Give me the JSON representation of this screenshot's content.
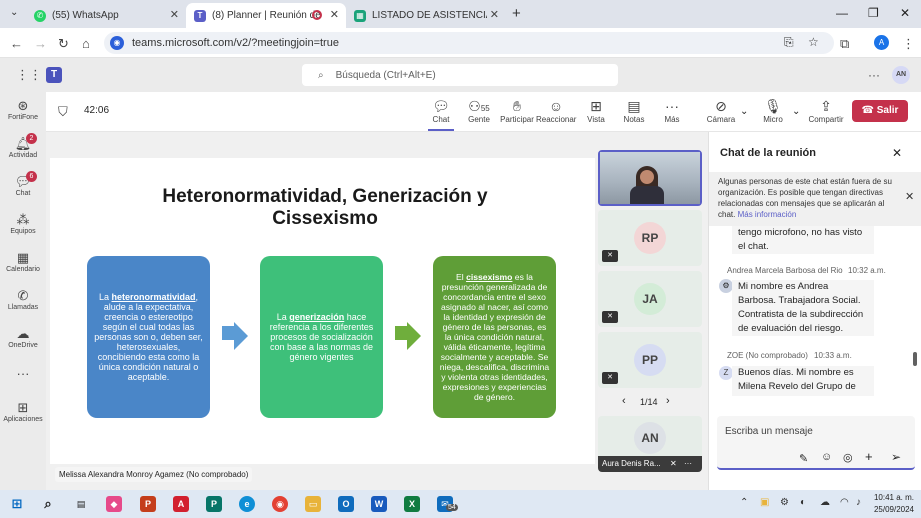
{
  "browser": {
    "tabs": [
      {
        "label": "(55) WhatsApp"
      },
      {
        "label": "(8) Planner | Reunión de Ma"
      },
      {
        "label": "LISTADO DE ASISTENCIA - ASIS"
      }
    ],
    "url": "teams.microsoft.com/v2/?meetingjoin=true",
    "profile": "A"
  },
  "teams": {
    "search_placeholder": "Búsqueda (Ctrl+Alt+E)",
    "user_initials": "AN",
    "rail": [
      {
        "label": "FortiFone",
        "badge": ""
      },
      {
        "label": "Actividad",
        "badge": "2"
      },
      {
        "label": "Chat",
        "badge": "6"
      },
      {
        "label": "Equipos",
        "badge": ""
      },
      {
        "label": "Calendario",
        "badge": ""
      },
      {
        "label": "Llamadas",
        "badge": ""
      },
      {
        "label": "OneDrive",
        "badge": ""
      },
      {
        "label": "Aplicaciones",
        "badge": ""
      }
    ]
  },
  "meeting": {
    "timer": "42:06",
    "people_count": "55",
    "toolbar": {
      "chat": "Chat",
      "people": "Gente",
      "raise": "Participar",
      "react": "Reaccionar",
      "view": "Vista",
      "notes": "Notas",
      "more": "Más",
      "camera": "Cámara",
      "mic": "Micro",
      "share": "Compartir",
      "leave": "Salir"
    },
    "slide": {
      "title": "Heteronormatividad, Generización y Cissexismo",
      "box1": "La heteronormatividad, alude a la expectativa, creencia o estereotipo según el cual todas las personas son o, deben ser, heterosexuales, concibiendo esta como la única condición natural o aceptable.",
      "box2": "La generización hace referencia a los diferentes procesos de socialización con base a las normas de género vigentes",
      "box3": "El cissexismo es la presunción generalizada de concordancia entre el sexo asignado al nacer, así como la identidad y expresión de género de las personas, es la única condición natural, válida éticamente, legítima socialmente y aceptable. Se niega, descalifica, discrimina y violenta otras identidades, expresiones y experiencias de género."
    },
    "presenter": "Melissa Alexandra Monroy Agamez (No comprobado)",
    "participants": [
      {
        "initials": "RP"
      },
      {
        "initials": "JA"
      },
      {
        "initials": "PP"
      }
    ],
    "pager": "1/14",
    "bottom_tile": {
      "initials": "AN",
      "name": "Aura Denis Ra..."
    }
  },
  "chat": {
    "title": "Chat de la reunión",
    "notice": "Algunas personas de este chat están fuera de su organización. Es posible que tengan directivas relacionadas con mensajes que se aplicarán al chat.",
    "notice_link": "Más información",
    "messages": [
      {
        "author": "",
        "time": "",
        "text": "tengo microfono, no has visto el chat."
      },
      {
        "author": "Andrea Marcela Barbosa del Rio",
        "time": "10:32 a.m.",
        "text": "Mi nombre es Andrea Barbosa. Trabajadora Social. Contratista de la subdirección de evaluación del riesgo."
      },
      {
        "author": "ZOE (No comprobado)",
        "time": "10:33 a.m.",
        "text": "Buenos días. Mi nombre es Milena Revelo del Grupo de"
      }
    ],
    "compose_placeholder": "Escriba un mensaje"
  },
  "taskbar": {
    "time": "10:41 a. m.",
    "date": "25/09/2024",
    "outlook_badge": "54"
  },
  "colors": {
    "box1": "#4a86c8",
    "box2": "#3ec07a",
    "box3": "#5f9e37",
    "accent": "#5b5fc7",
    "leave": "#c4314b"
  }
}
